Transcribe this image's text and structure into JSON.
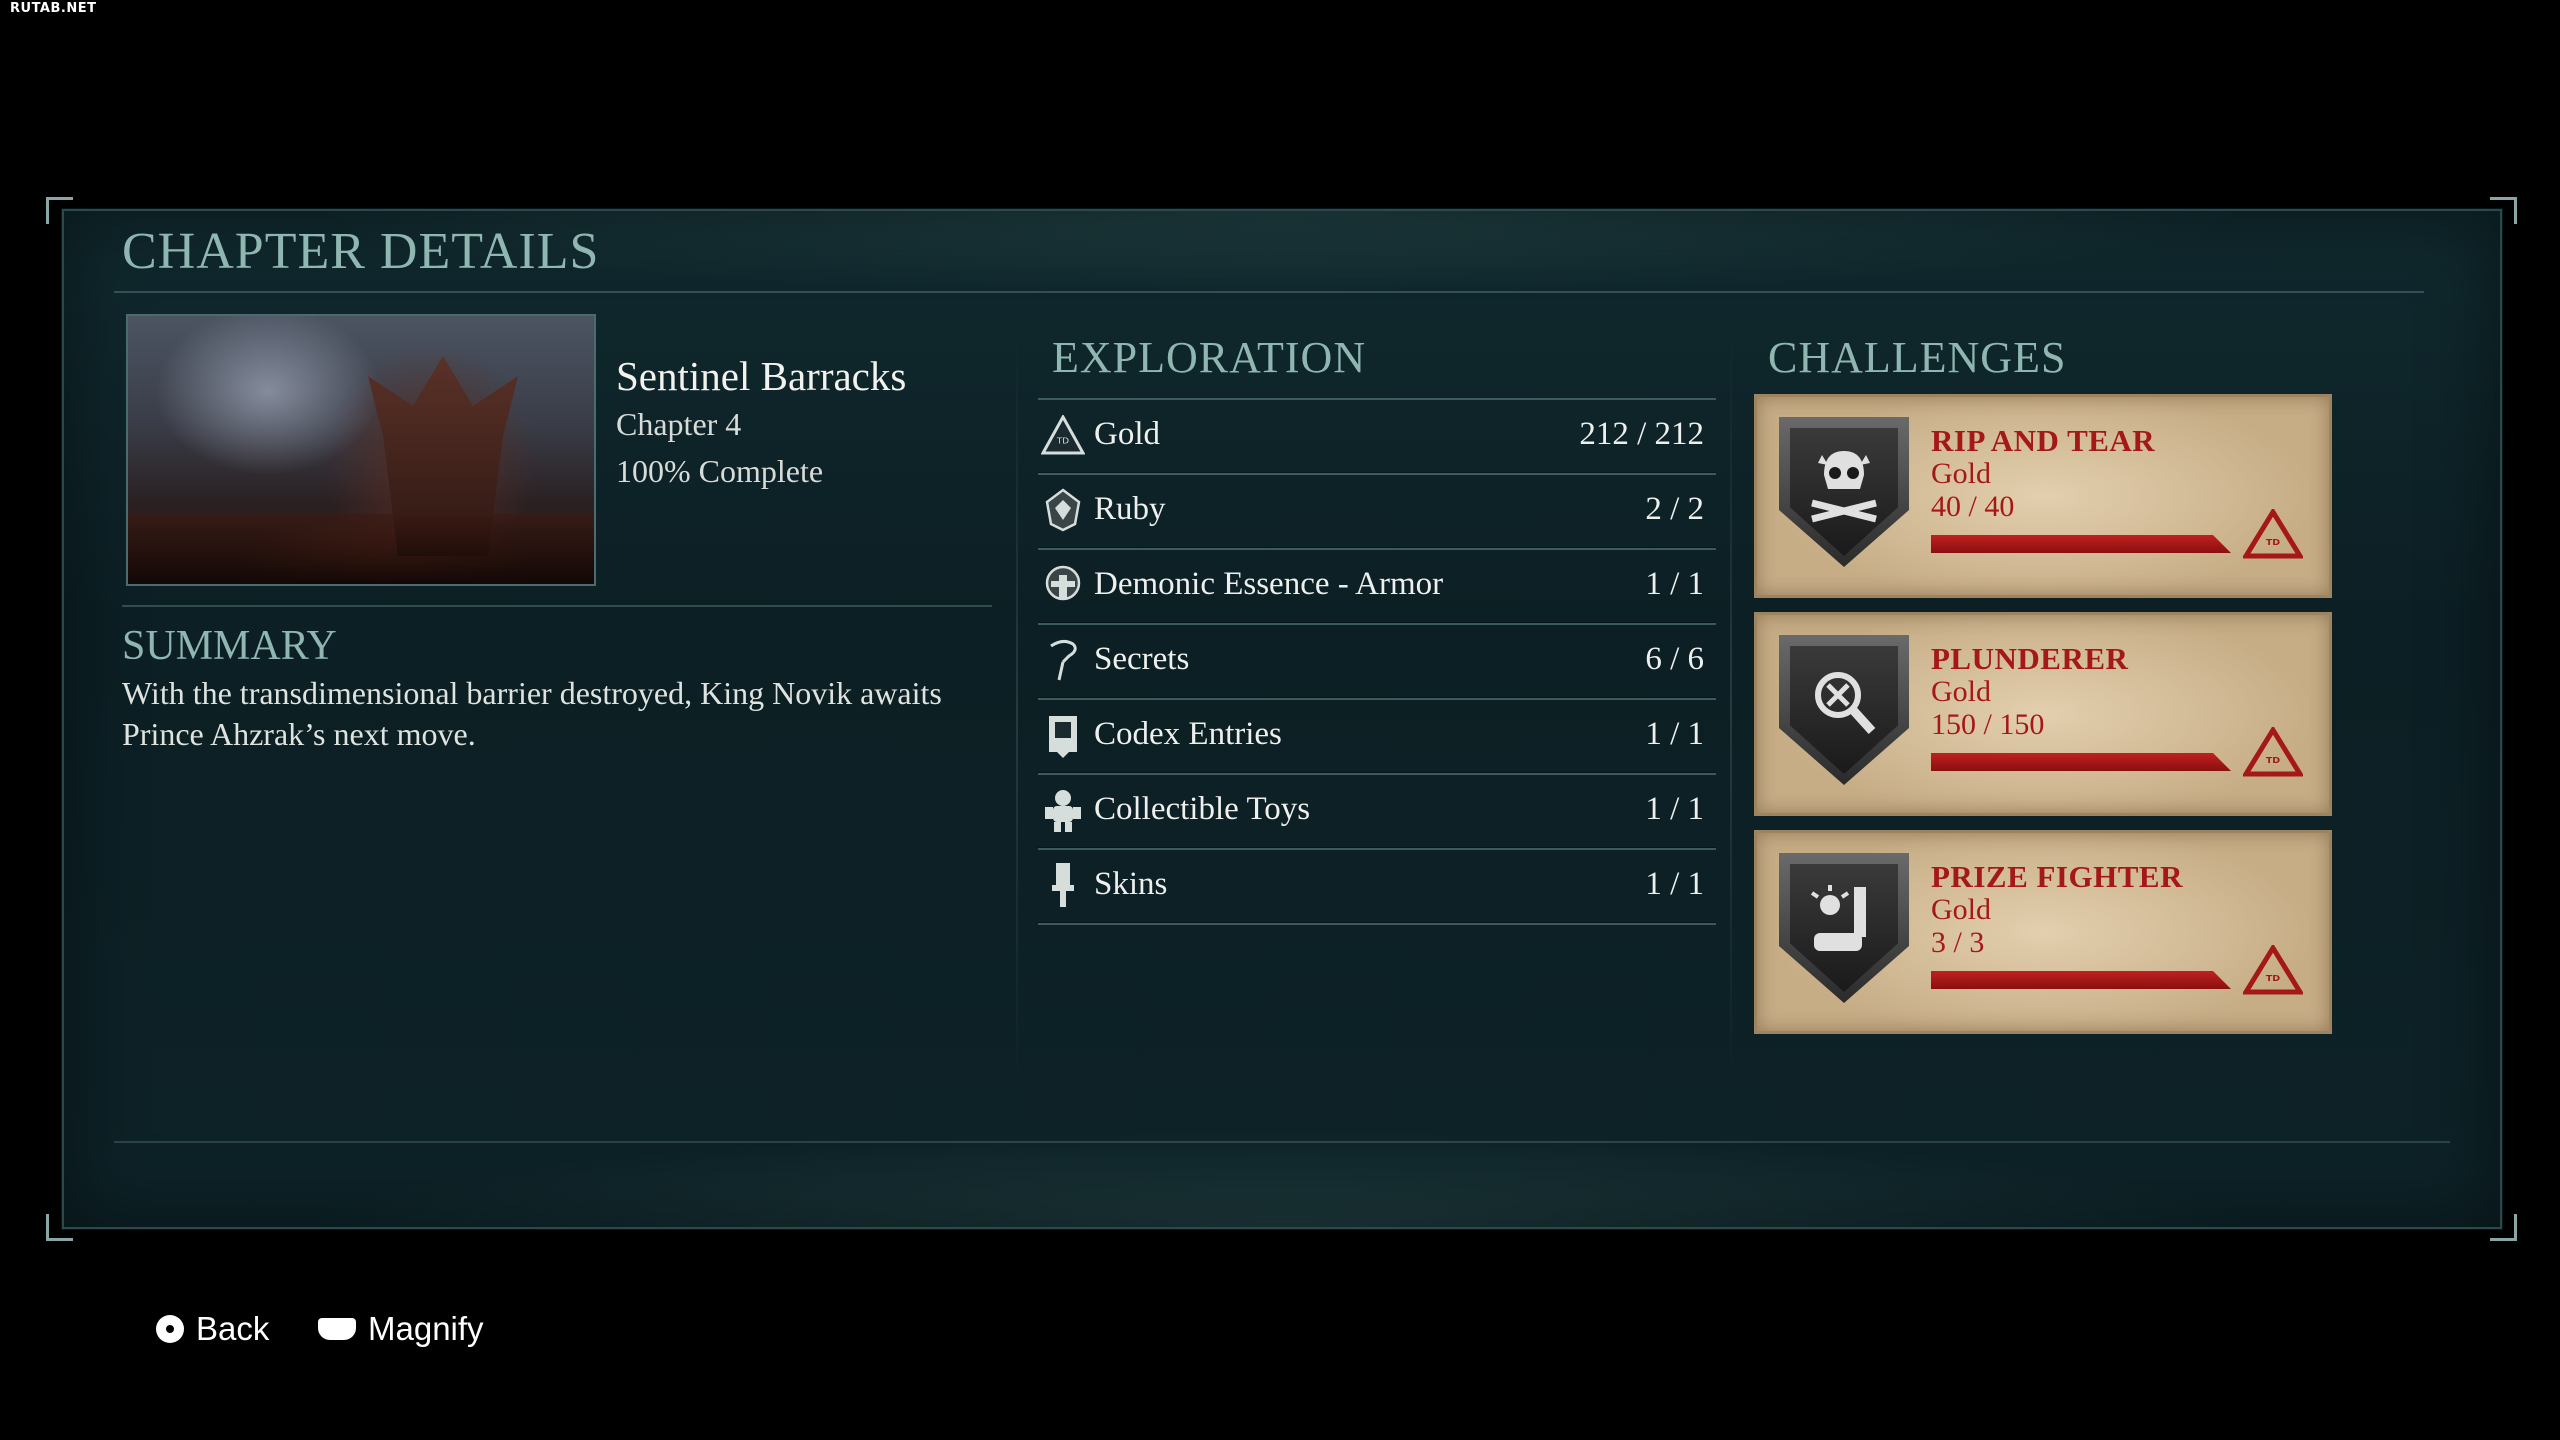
{
  "watermark": "RUTAB.NET",
  "panel": {
    "title": "CHAPTER DETAILS"
  },
  "chapter": {
    "name": "Sentinel Barracks",
    "number": "Chapter 4",
    "completion": "100% Complete"
  },
  "summary": {
    "title": "SUMMARY",
    "text": "With the transdimensional barrier destroyed, King Novik awaits Prince Ahzrak’s next move."
  },
  "exploration": {
    "title": "EXPLORATION",
    "items": [
      {
        "icon": "gold-icon",
        "label": "Gold",
        "count": "212 / 212"
      },
      {
        "icon": "ruby-icon",
        "label": "Ruby",
        "count": "2 / 2"
      },
      {
        "icon": "demonic-essence-icon",
        "label": "Demonic Essence - Armor",
        "count": "1 / 1"
      },
      {
        "icon": "secrets-icon",
        "label": "Secrets",
        "count": "6 / 6"
      },
      {
        "icon": "codex-icon",
        "label": "Codex Entries",
        "count": "1 / 1"
      },
      {
        "icon": "toy-icon",
        "label": "Collectible Toys",
        "count": "1 / 1"
      },
      {
        "icon": "skins-icon",
        "label": "Skins",
        "count": "1 / 1"
      }
    ]
  },
  "challenges": {
    "title": "CHALLENGES",
    "items": [
      {
        "icon": "skull-crossbones-icon",
        "name": "RIP AND TEAR",
        "tier": "Gold",
        "progress": "40 / 40",
        "fraction": 1.0
      },
      {
        "icon": "magnifier-icon",
        "name": "PLUNDERER",
        "tier": "Gold",
        "progress": "150 / 150",
        "fraction": 1.0
      },
      {
        "icon": "weapons-icon",
        "name": "PRIZE FIGHTER",
        "tier": "Gold",
        "progress": "3 / 3",
        "fraction": 1.0
      }
    ]
  },
  "footer": {
    "back_label": "Back",
    "magnify_label": "Magnify"
  }
}
